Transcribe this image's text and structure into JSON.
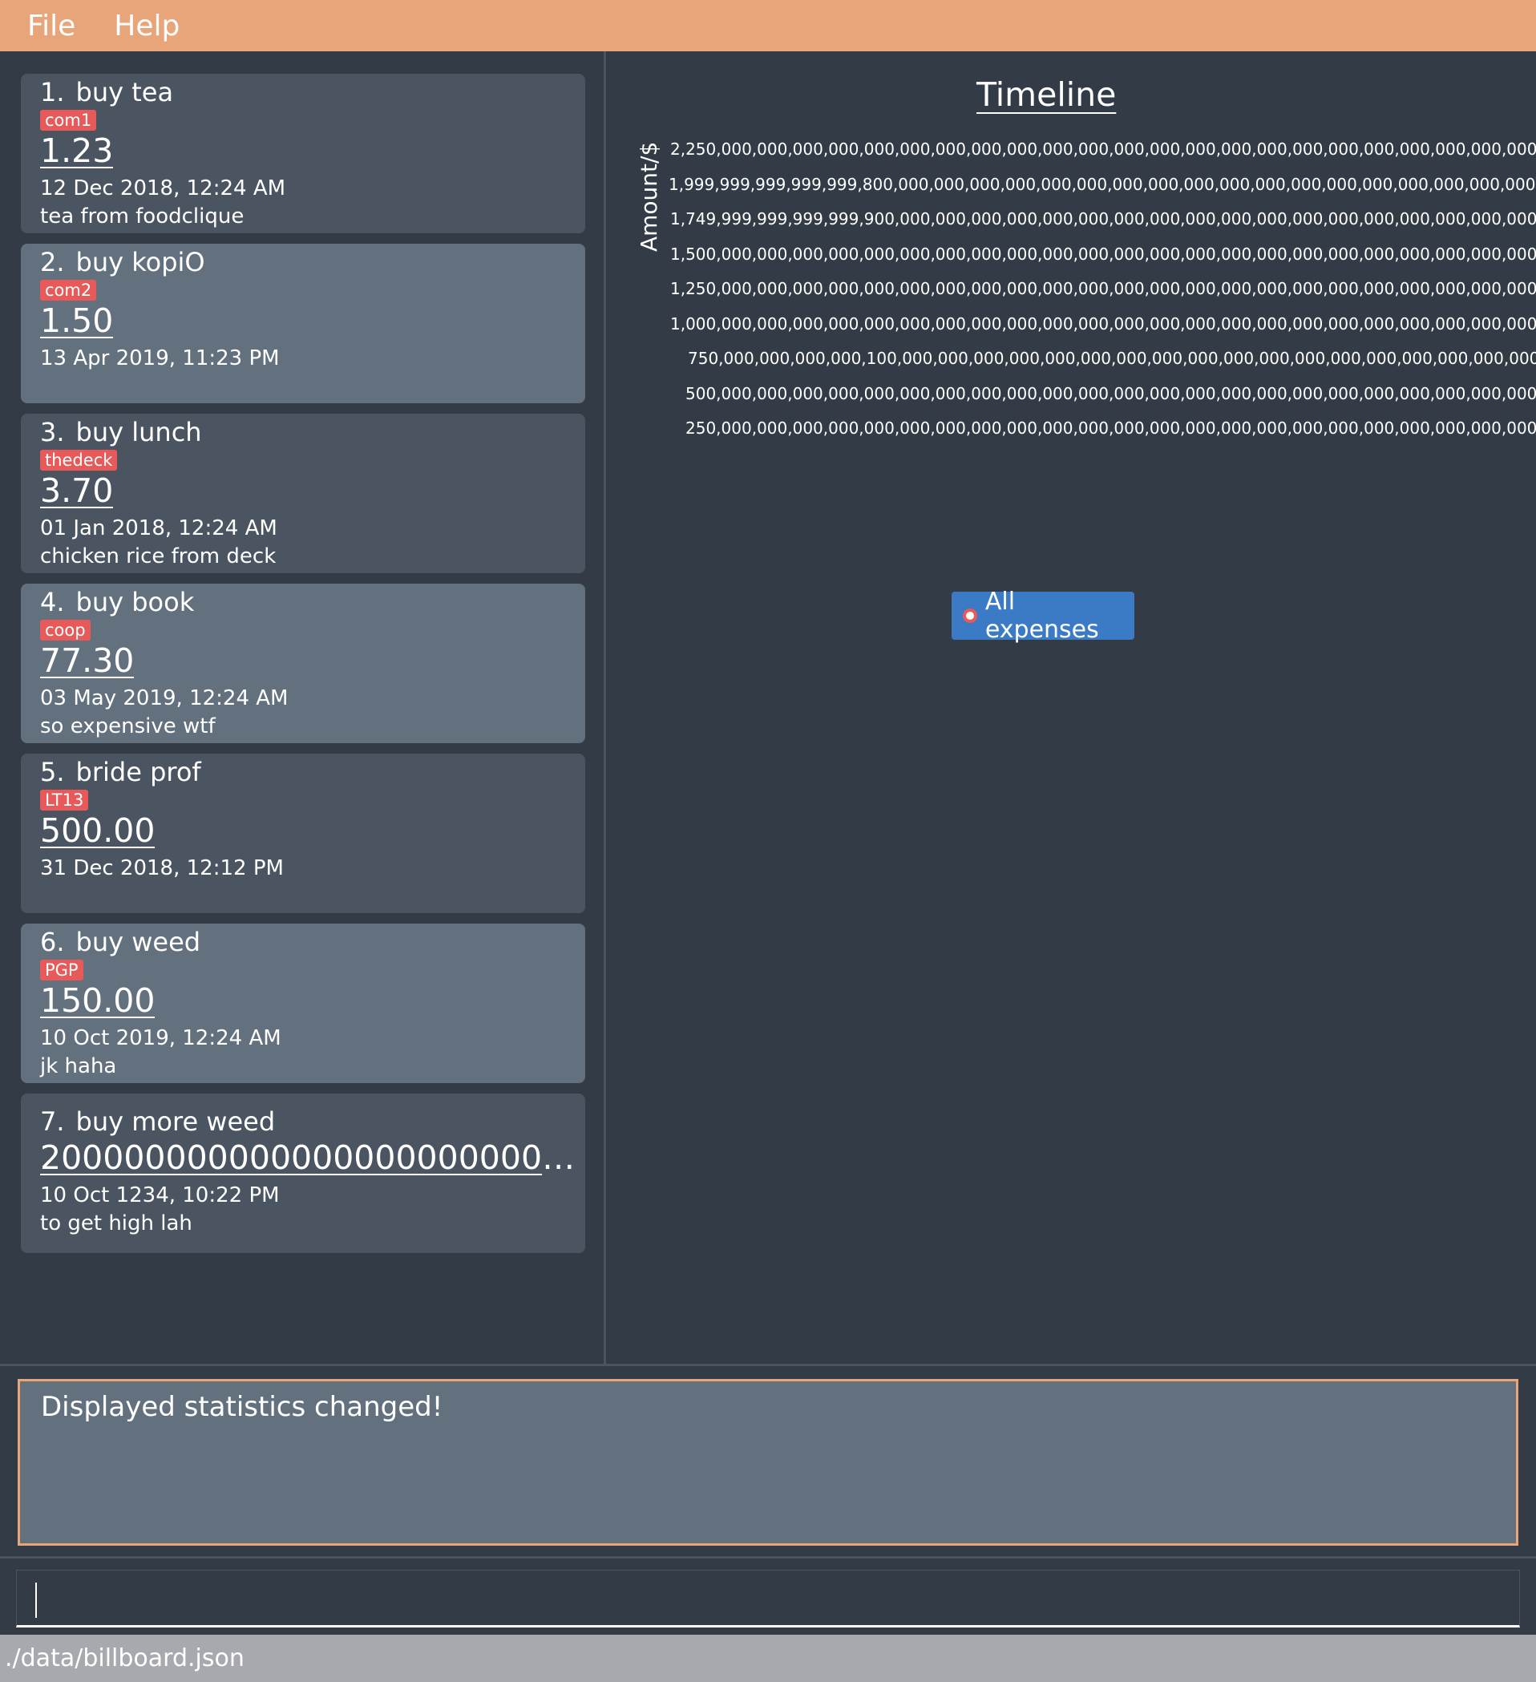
{
  "menu": {
    "file": "File",
    "help": "Help"
  },
  "expenses": [
    {
      "index": "1.",
      "name": "buy tea",
      "tag": "com1",
      "amount": "1.23",
      "date": "12 Dec 2018, 12:24 AM",
      "description": "tea from foodclique"
    },
    {
      "index": "2.",
      "name": "buy kopiO",
      "tag": "com2",
      "amount": "1.50",
      "date": "13 Apr 2019, 11:23 PM",
      "description": ""
    },
    {
      "index": "3.",
      "name": "buy lunch",
      "tag": "thedeck",
      "amount": "3.70",
      "date": "01 Jan 2018, 12:24 AM",
      "description": "chicken rice from deck"
    },
    {
      "index": "4.",
      "name": "buy book",
      "tag": "coop",
      "amount": "77.30",
      "date": "03 May 2019, 12:24 AM",
      "description": "so expensive wtf"
    },
    {
      "index": "5.",
      "name": "bride prof",
      "tag": "LT13",
      "amount": "500.00",
      "date": "31 Dec 2018, 12:12 PM",
      "description": ""
    },
    {
      "index": "6.",
      "name": "buy weed",
      "tag": "PGP",
      "amount": "150.00",
      "date": "10 Oct 2019, 12:24 AM",
      "description": "jk haha"
    },
    {
      "index": "7.",
      "name": "buy more weed",
      "tag": "",
      "amount": "2000000000000000000000000...",
      "date": "10 Oct 1234, 10:22 PM",
      "description": "to get high lah"
    }
  ],
  "chart": {
    "title": "Timeline",
    "ylabel": "Amount/$",
    "ticks": [
      "2,250,000,000,000,000,000,000,000,000,000,000,000,000,000,000,000,000,000,000,000,000,000,000,000,000,000,00",
      "1,999,999,999,999,999,800,000,000,000,000,000,000,000,000,000,000,000,000,000,000,000,000,000,000,000,000,00",
      "1,749,999,999,999,999,900,000,000,000,000,000,000,000,000,000,000,000,000,000,000,000,000,000,000,000,000,00",
      "1,500,000,000,000,000,000,000,000,000,000,000,000,000,000,000,000,000,000,000,000,000,000,000,000,000,000,00",
      "1,250,000,000,000,000,000,000,000,000,000,000,000,000,000,000,000,000,000,000,000,000,000,000,000,000,000,00",
      "1,000,000,000,000,000,000,000,000,000,000,000,000,000,000,000,000,000,000,000,000,000,000,000,000,000,000,00",
      "750,000,000,000,000,100,000,000,000,000,000,000,000,000,000,000,000,000,000,000,000,000,000,000,000,000,00",
      "500,000,000,000,000,000,000,000,000,000,000,000,000,000,000,000,000,000,000,000,000,000,000,000,000,000,00",
      "250,000,000,000,000,000,000,000,000,000,000,000,000,000,000,000,000,000,000,000,000,000,000,000,000,000,00"
    ],
    "legend": "All expenses"
  },
  "result": {
    "message": "Displayed statistics changed!"
  },
  "command": {
    "value": ""
  },
  "status": {
    "file_path": "./data/billboard.json"
  }
}
